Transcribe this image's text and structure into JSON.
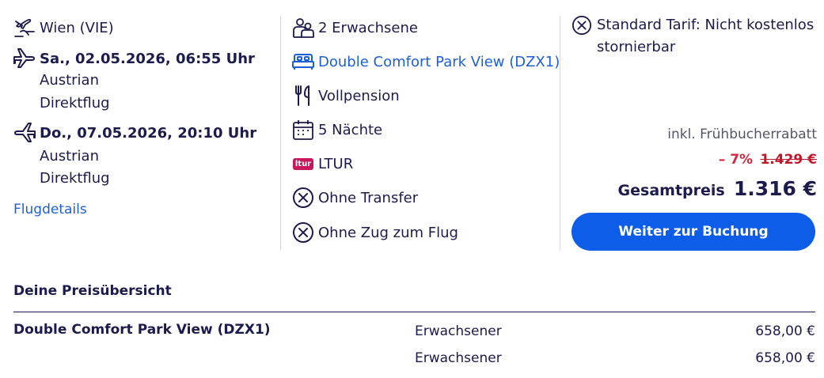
{
  "flight": {
    "origin": "Wien (VIE)",
    "outbound": {
      "datetime": "Sa., 02.05.2026, 06:55 Uhr",
      "airline": "Austrian",
      "type": "Direktflug"
    },
    "inbound": {
      "datetime": "Do., 07.05.2026, 20:10 Uhr",
      "airline": "Austrian",
      "type": "Direktflug"
    },
    "details_link": "Flugdetails"
  },
  "hotel": {
    "travellers": "2 Erwachsene",
    "room": "Double Comfort Park View (DZX1)",
    "board": "Vollpension",
    "nights": "5 Nächte",
    "operator_logo": "ltur",
    "operator": "LTUR",
    "transfer": "Ohne Transfer",
    "train": "Ohne Zug zum Flug"
  },
  "pricing": {
    "tariff": "Standard Tarif: Nicht kostenlos stornierbar",
    "discount_label": "inkl. Frühbucherrabatt",
    "discount_percent": "– 7%",
    "old_price": "1.429 €",
    "total_label": "Gesamtpreis",
    "total_price": "1.316 €",
    "cta": "Weiter zur Buchung"
  },
  "price_overview": {
    "title": "Deine Preisübersicht",
    "room": "Double Comfort Park View (DZX1)",
    "rows": [
      {
        "type": "Erwachsener",
        "price": "658,00 €"
      },
      {
        "type": "Erwachsener",
        "price": "658,00 €"
      }
    ]
  },
  "colors": {
    "text": "#1c1b4d",
    "link": "#1d5fd6",
    "cta": "#0d5de8",
    "discount": "#d7263d",
    "ltur": "#c8175d"
  },
  "icons": [
    "plane-route-icon",
    "plane-outbound-icon",
    "plane-inbound-icon",
    "people-icon",
    "bed-icon",
    "cutlery-icon",
    "calendar-icon",
    "ltur-logo",
    "x-circle-icon"
  ]
}
